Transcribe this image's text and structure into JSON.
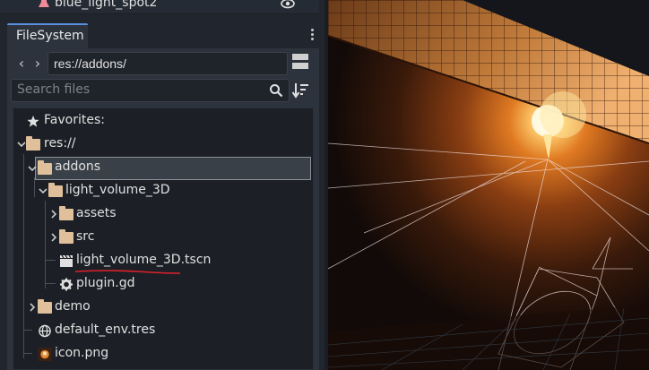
{
  "scene_tree": {
    "partial_item": {
      "label": "blue_light_spot2",
      "icon": "spotlight-icon",
      "visibility_icon": "eye-icon"
    }
  },
  "filesystem": {
    "tab_label": "FileSystem",
    "menu_icon": "kebab-menu-icon",
    "back_icon": "chevron-left-icon",
    "forward_icon": "chevron-right-icon",
    "path": "res://addons/",
    "layout_icon": "split-layout-icon",
    "search": {
      "placeholder": "Search files",
      "icon": "search-icon"
    },
    "sort_icon": "sort-icon",
    "tree": {
      "favorites": "Favorites:",
      "root": "res://",
      "addons": "addons",
      "light_volume": "light_volume_3D",
      "assets": "assets",
      "src": "src",
      "scene_file": "light_volume_3D.tscn",
      "plugin_file": "plugin.gd",
      "demo": "demo",
      "env_file": "default_env.tres",
      "icon_file": "icon.png"
    }
  },
  "colors": {
    "folder": "#e0c09a",
    "annotation": "#e0202a",
    "accent": "#5a8ee0"
  }
}
